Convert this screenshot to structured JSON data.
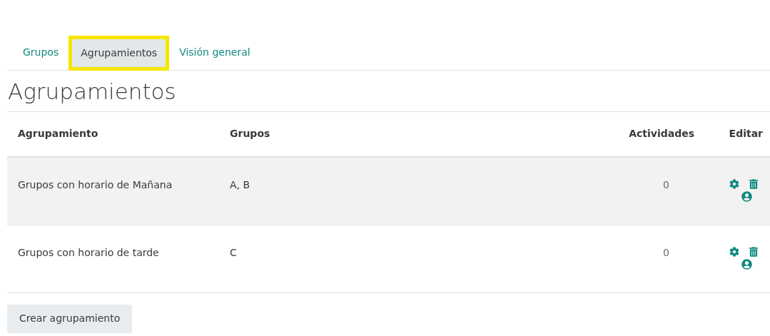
{
  "tabs": [
    {
      "label": "Grupos",
      "selected": false
    },
    {
      "label": "Agrupamientos",
      "selected": true
    },
    {
      "label": "Visión general",
      "selected": false
    }
  ],
  "heading": "Agrupamientos",
  "table": {
    "columns": [
      "Agrupamiento",
      "Grupos",
      "Actividades",
      "Editar"
    ],
    "rows": [
      {
        "name": "Grupos con horario de Mañana",
        "groups": "A, B",
        "activities": "0",
        "selected": true
      },
      {
        "name": "Grupos con horario de tarde",
        "groups": "C",
        "activities": "0",
        "selected": false
      }
    ]
  },
  "button": "Crear agrupamiento"
}
